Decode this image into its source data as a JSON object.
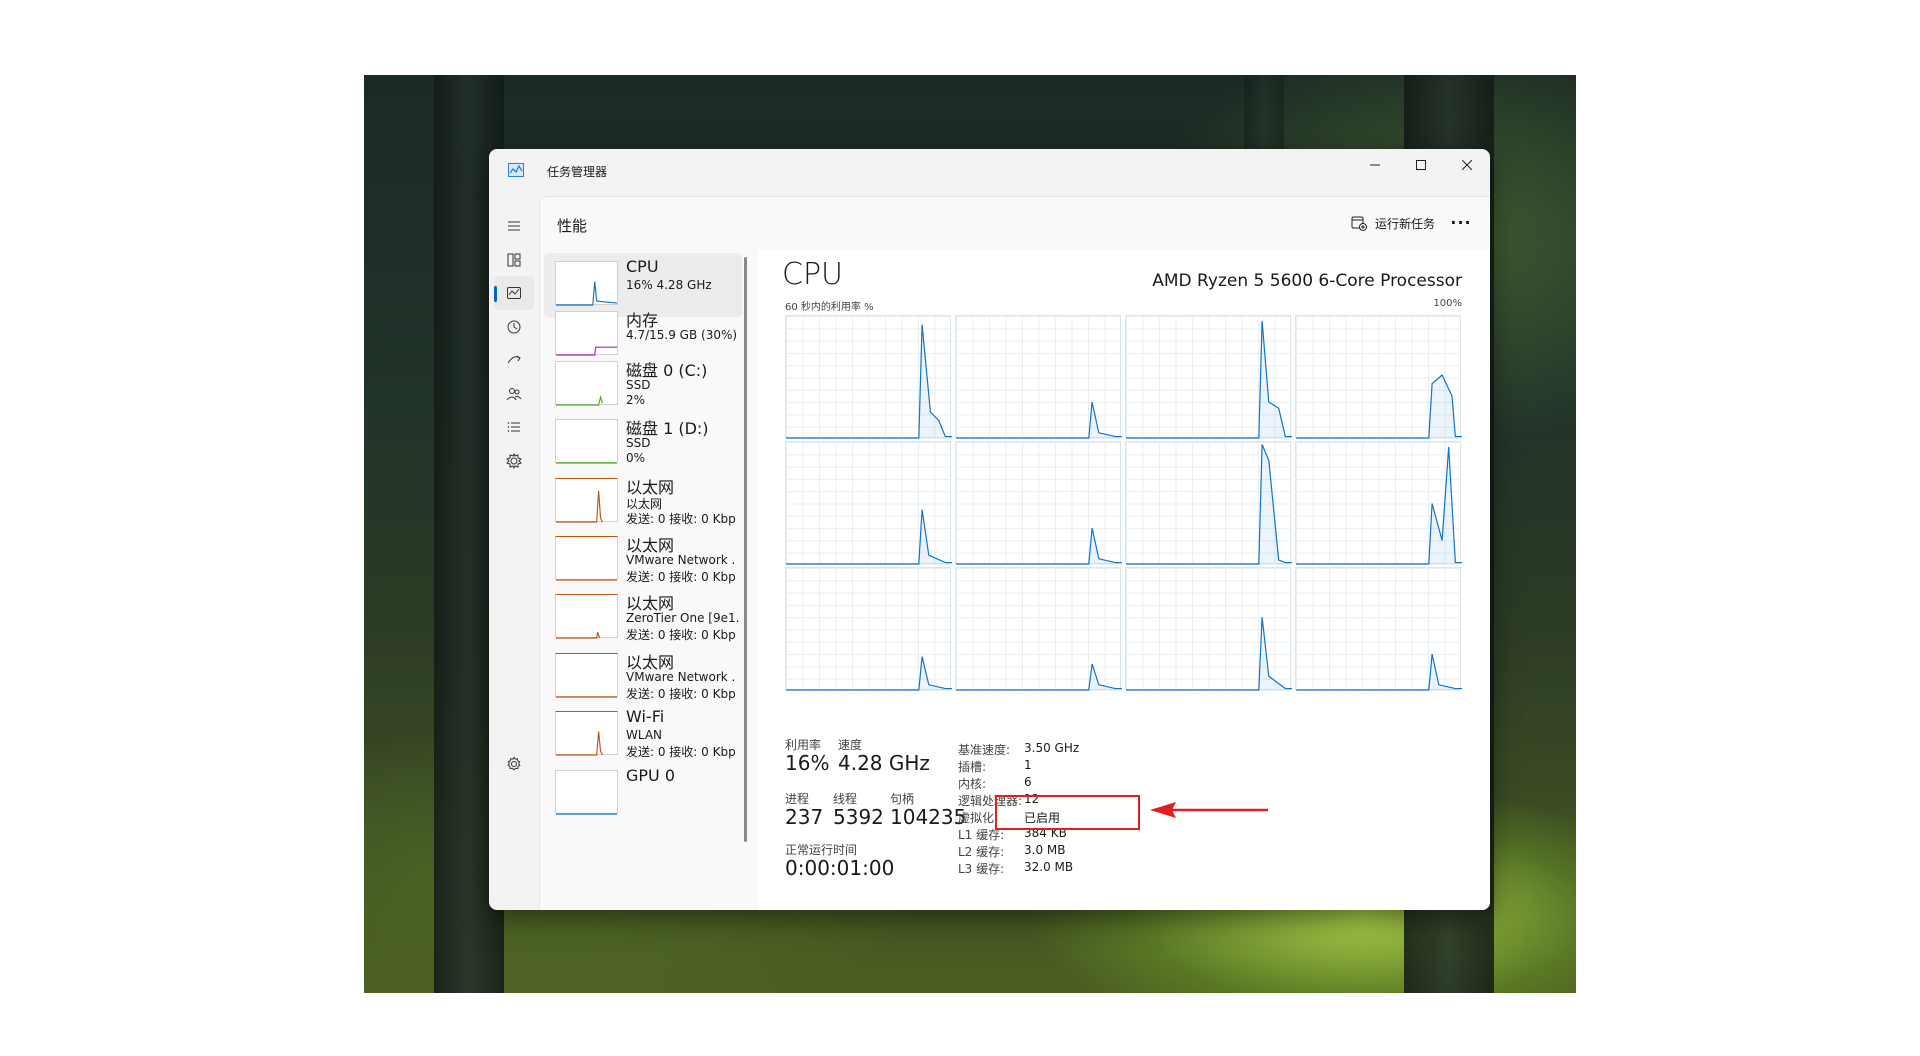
{
  "window": {
    "title": "任务管理器"
  },
  "header": {
    "title": "性能",
    "run_task_label": "运行新任务",
    "more_label": "···"
  },
  "nav": [
    {
      "icon": "hamburger-menu-icon"
    },
    {
      "icon": "processes-icon"
    },
    {
      "icon": "performance-icon",
      "active": true
    },
    {
      "icon": "app-history-icon"
    },
    {
      "icon": "startup-apps-icon"
    },
    {
      "icon": "users-icon"
    },
    {
      "icon": "details-icon"
    },
    {
      "icon": "services-icon"
    },
    {
      "icon": "settings-icon"
    }
  ],
  "devices": [
    {
      "name": "CPU",
      "line1": "16% 4.28 GHz",
      "line2": "",
      "color": "#1174c6",
      "selected": true
    },
    {
      "name": "内存",
      "line1": "4.7/15.9 GB (30%)",
      "line2": "",
      "color": "#a02aa0"
    },
    {
      "name": "磁盘 0 (C:)",
      "line1": "SSD",
      "line2": "2%",
      "color": "#4caf20"
    },
    {
      "name": "磁盘 1 (D:)",
      "line1": "SSD",
      "line2": "0%",
      "color": "#4caf20"
    },
    {
      "name": "以太网",
      "line1": "以太网",
      "line2": "发送: 0 接收: 0 Kbp",
      "color": "#c4531a"
    },
    {
      "name": "以太网",
      "line1": "VMware Network .",
      "line2": "发送: 0 接收: 0 Kbp",
      "color": "#c4531a"
    },
    {
      "name": "以太网",
      "line1": "ZeroTier One [9e1.",
      "line2": "发送: 0 接收: 0 Kbp",
      "color": "#c4531a"
    },
    {
      "name": "以太网",
      "line1": "VMware Network .",
      "line2": "发送: 0 接收: 0 Kbp",
      "color": "#c4531a"
    },
    {
      "name": "Wi-Fi",
      "line1": "WLAN",
      "line2": "发送: 0 接收: 0 Kbp",
      "color": "#c4531a"
    },
    {
      "name": "GPU 0",
      "line1": "",
      "line2": "",
      "color": "#1174c6"
    }
  ],
  "cpu": {
    "title": "CPU",
    "model": "AMD Ryzen 5 5600 6-Core Processor",
    "graph_label": "60 秒内的利用率 %",
    "graph_max": "100%",
    "utilization_label": "利用率",
    "utilization": "16%",
    "speed_label": "速度",
    "speed": "4.28 GHz",
    "processes_label": "进程",
    "processes": "237",
    "threads_label": "线程",
    "threads": "5392",
    "handles_label": "句柄",
    "handles": "104235",
    "uptime_label": "正常运行时间",
    "uptime": "0:00:01:00",
    "specs": [
      {
        "label": "基准速度:",
        "value": "3.50 GHz"
      },
      {
        "label": "插槽:",
        "value": "1"
      },
      {
        "label": "内核:",
        "value": "6"
      },
      {
        "label": "逻辑处理器:",
        "value": "12"
      },
      {
        "label": "虚拟化:",
        "value": "已启用"
      },
      {
        "label": "L1 缓存:",
        "value": "384 KB"
      },
      {
        "label": "L2 缓存:",
        "value": "3.0 MB"
      },
      {
        "label": "L3 缓存:",
        "value": "32.0 MB"
      }
    ]
  },
  "graph_color": "#1174c6"
}
